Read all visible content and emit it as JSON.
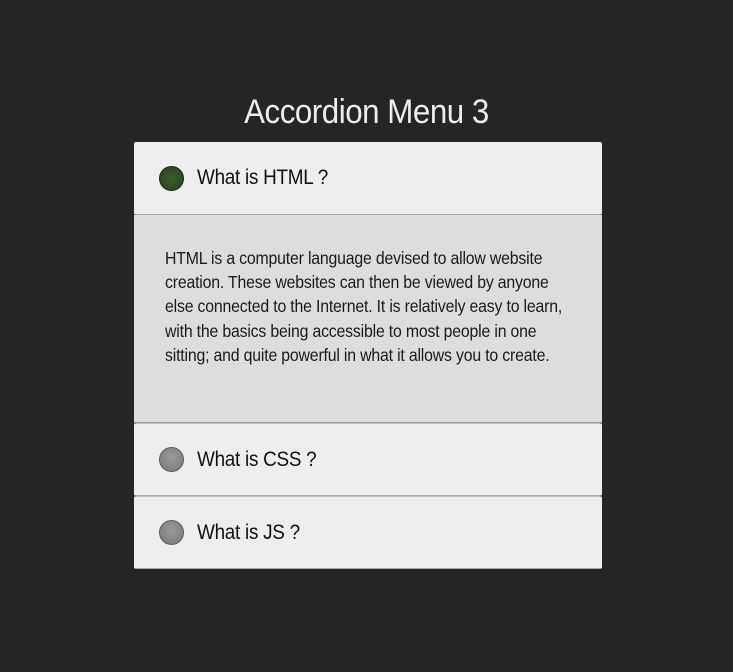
{
  "title": "Accordion Menu 3",
  "accordion": {
    "items": [
      {
        "question": "What is HTML ?",
        "expanded": true,
        "answer": "HTML is a computer language devised to allow website creation. These websites can then be viewed by anyone else connected to the Internet. It is relatively easy to learn, with the basics being accessible to most people in one sitting; and quite powerful in what it allows you to create."
      },
      {
        "question": "What is CSS ?",
        "expanded": false
      },
      {
        "question": "What is JS ?",
        "expanded": false
      }
    ]
  },
  "colors": {
    "background": "#252525",
    "header_bg": "#eeeeee",
    "panel_bg": "#dddddd",
    "active_dot": "#2e4a22",
    "inactive_dot": "#828282",
    "title_text": "#ededed"
  }
}
